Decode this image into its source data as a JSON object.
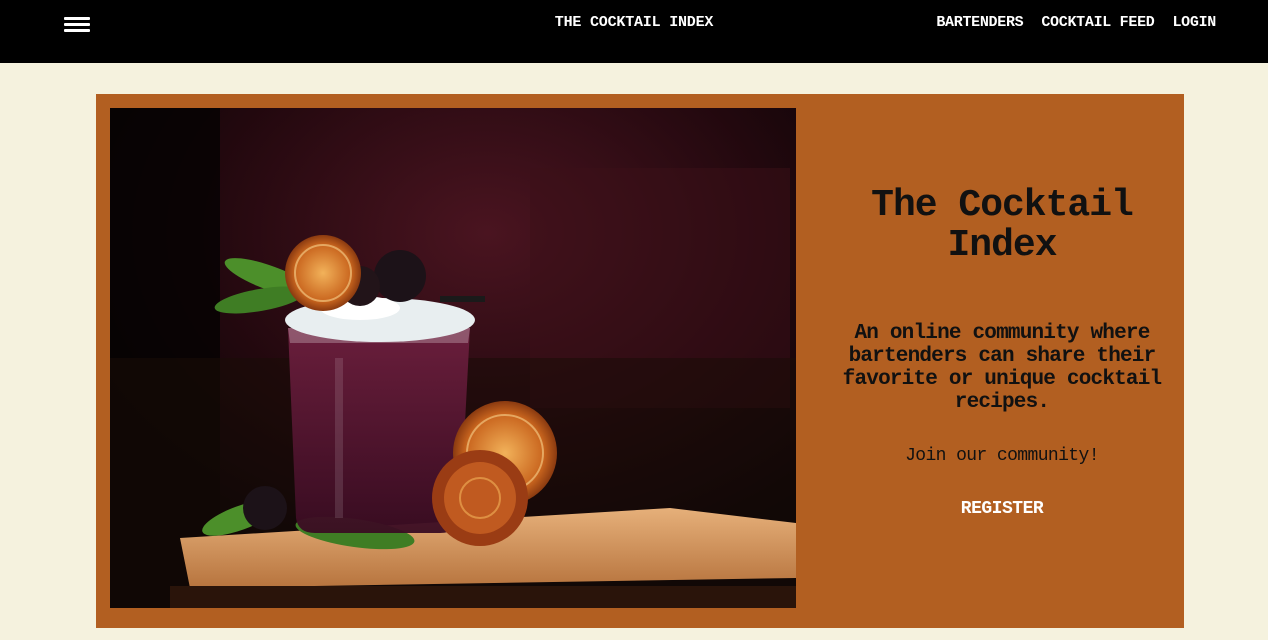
{
  "navbar": {
    "brand": "THE COCKTAIL INDEX",
    "links": [
      "BARTENDERS",
      "COCKTAIL FEED",
      "LOGIN"
    ],
    "menu_icon": "hamburger-icon"
  },
  "hero": {
    "image_subject": "cocktail-photo",
    "title_line1": "The Cocktail",
    "title_line2": "Index",
    "description": "An online community where bartenders can share their favorite or unique cocktail recipes.",
    "join_text": "Join our community!",
    "register_label": "REGISTER"
  },
  "colors": {
    "navbar_bg": "#000000",
    "page_bg": "#f5f2de",
    "card_bg": "#b25f21"
  }
}
